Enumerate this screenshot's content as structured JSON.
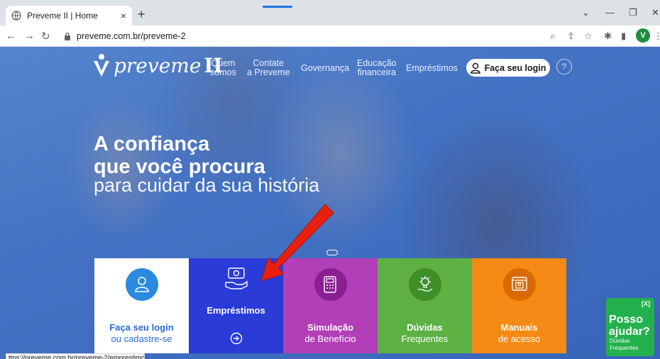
{
  "browser": {
    "tab_title": "Preveme II | Home",
    "tab_close": "×",
    "new_tab": "+",
    "url": "preveme.com.br/preveme-2",
    "profile_initial": "V",
    "status_url": "ttps://preveme.com.br/preveme-2/emprestimos",
    "win_minimize": "—",
    "win_restore": "❐",
    "win_close": "✕",
    "win_chevron": "⌄"
  },
  "site": {
    "logo_text": "preveme",
    "logo_suffix": "II",
    "nav": {
      "quem_line1": "Quem",
      "quem_line2": "somos",
      "contate_line1": "Contate",
      "contate_line2": "a Preveme",
      "governanca": "Governança",
      "educacao_line1": "Educação",
      "educacao_line2": "financeira",
      "emprestimos": "Empréstimos",
      "login": "Faça seu login"
    },
    "hero": {
      "line1": "A confiança",
      "line2": "que você procura",
      "line3": "para cuidar da sua história"
    },
    "cards": {
      "login_title": "Faça seu login",
      "login_sub": "ou cadastre-se",
      "emprestimos_title": "Empréstimos",
      "simulacao_title": "Simulação",
      "simulacao_sub": "de Benefício",
      "duvidas_title": "Dúvidas",
      "duvidas_sub": "Frequentes",
      "manuais_title": "Manuais",
      "manuais_sub": "de acesso"
    },
    "chat": {
      "close": "[X]",
      "line1": "Posso",
      "line2": "ajudar?",
      "small1": "Dúvidas",
      "small2": "Frequentes"
    }
  },
  "colors": {
    "card_login": "#ffffff",
    "card_emprestimos": "#2a3bd8",
    "card_simulacao": "#b23eb8",
    "card_duvidas": "#5db142",
    "card_manuais": "#f58a14",
    "accent_blue": "#2a8ae0",
    "arrow_red": "#e8200f",
    "chat_green": "#22b14c"
  }
}
